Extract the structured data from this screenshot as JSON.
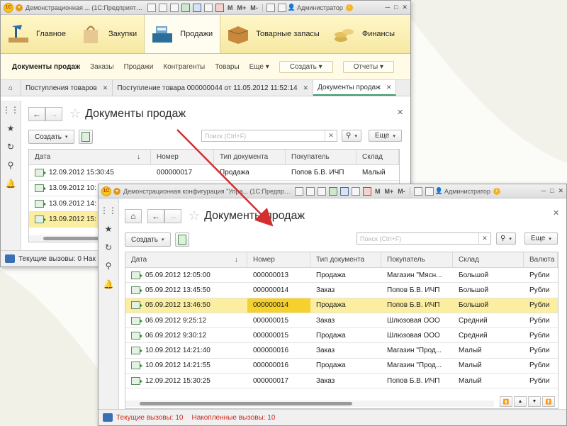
{
  "window_back": {
    "title": "Демонстрационная ... (1С:Предприятие)",
    "user": "Администратор",
    "sections": [
      {
        "label": "Главное"
      },
      {
        "label": "Закупки"
      },
      {
        "label": "Продажи"
      },
      {
        "label": "Товарные запасы"
      },
      {
        "label": "Финансы"
      }
    ],
    "commands": {
      "current": "Документы продаж",
      "items": [
        "Заказы",
        "Продажи",
        "Контрагенты",
        "Товары",
        "Еще"
      ],
      "create": "Создать",
      "reports": "Отчеты"
    },
    "tabs": [
      "Поступления товаров",
      "Поступление товара 000000044 от 11.05.2012 11:52:14",
      "Документы продаж"
    ],
    "form_title": "Документы продаж",
    "create_label": "Создать",
    "search_placeholder": "Поиск (Ctrl+F)",
    "more_label": "Еще",
    "columns": [
      "Дата",
      "Номер",
      "Тип документа",
      "Покупатель",
      "Склад"
    ],
    "rows": [
      {
        "date": "12.09.2012 15:30:45",
        "number": "000000017",
        "type": "Продажа",
        "buyer": "Попов Б.В. ИЧП",
        "warehouse": "Малый"
      },
      {
        "date": "13.09.2012 10:",
        "number": "",
        "type": "",
        "buyer": "",
        "warehouse": ""
      },
      {
        "date": "13.09.2012 14:",
        "number": "",
        "type": "",
        "buyer": "",
        "warehouse": ""
      },
      {
        "date": "13.09.2012 15:",
        "number": "",
        "type": "",
        "buyer": "",
        "warehouse": ""
      }
    ],
    "status": "Текущие вызовы: 0   Нак"
  },
  "window_front": {
    "title": "Демонстрационная конфигурация \"Упра... (1С:Предприятие)",
    "user": "Администратор",
    "form_title": "Документы продаж",
    "create_label": "Создать",
    "search_placeholder": "Поиск (Ctrl+F)",
    "more_label": "Еще",
    "columns": [
      "Дата",
      "Номер",
      "Тип документа",
      "Покупатель",
      "Склад",
      "Валюта"
    ],
    "rows": [
      {
        "date": "05.09.2012 12:05:00",
        "number": "000000013",
        "type": "Продажа",
        "buyer": "Магазин \"Мясн...",
        "warehouse": "Большой",
        "currency": "Рубли"
      },
      {
        "date": "05.09.2012 13:45:50",
        "number": "000000014",
        "type": "Заказ",
        "buyer": "Попов Б.В. ИЧП",
        "warehouse": "Большой",
        "currency": "Рубли"
      },
      {
        "date": "05.09.2012 13:46:50",
        "number": "000000014",
        "type": "Продажа",
        "buyer": "Попов Б.В. ИЧП",
        "warehouse": "Большой",
        "currency": "Рубли"
      },
      {
        "date": "06.09.2012 9:25:12",
        "number": "000000015",
        "type": "Заказ",
        "buyer": "Шлюзовая ООО",
        "warehouse": "Средний",
        "currency": "Рубли"
      },
      {
        "date": "06.09.2012 9:30:12",
        "number": "000000015",
        "type": "Продажа",
        "buyer": "Шлюзовая ООО",
        "warehouse": "Средний",
        "currency": "Рубли"
      },
      {
        "date": "10.09.2012 14:21:40",
        "number": "000000016",
        "type": "Заказ",
        "buyer": "Магазин \"Прод...",
        "warehouse": "Малый",
        "currency": "Рубли"
      },
      {
        "date": "10.09.2012 14:21:55",
        "number": "000000016",
        "type": "Продажа",
        "buyer": "Магазин \"Прод...",
        "warehouse": "Малый",
        "currency": "Рубли"
      },
      {
        "date": "12.09.2012 15:30:25",
        "number": "000000017",
        "type": "Заказ",
        "buyer": "Попов Б.В. ИЧП",
        "warehouse": "Малый",
        "currency": "Рубли"
      }
    ],
    "status_current": "Текущие вызовы: 10",
    "status_accum": "Накопленные вызовы: 10"
  },
  "colors": {
    "accent_yellow": "#fbeea0",
    "selected_cell": "#f6d12e",
    "status_red": "#d0281c",
    "arrow_red": "#d32f2f"
  }
}
